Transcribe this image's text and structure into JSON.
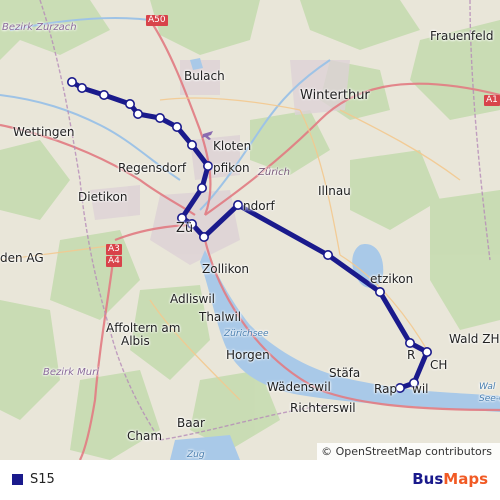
{
  "map": {
    "attribution": "© OpenStreetMap contributors",
    "labels": {
      "bezirk_zurzach": "Bezirk Zurzach",
      "bulach": "Bulach",
      "winterthur": "Winterthur",
      "frauenfeld": "Frauenfeld",
      "wettingen": "Wettingen",
      "kloten": "Kloten",
      "regensdorf": "Regensdorf",
      "opfikon": "pfikon",
      "zurich_italic": "Zürich",
      "illnau": "Illnau",
      "dietikon": "Dietikon",
      "zurich": "Zü",
      "dorf": "ndorf",
      "wetzikon": "etzikon",
      "zollikon": "Zollikon",
      "wald": "Wald ZH",
      "den_ag": "den AG",
      "adliswil": "Adliswil",
      "affoltern1": "Affoltern am",
      "affoltern2": "Albis",
      "thalwil": "Thalwil",
      "zurichsee": "Zürichsee",
      "horgen": "Horgen",
      "bezirk_muri": "Bezirk Muri",
      "stafa": "Stäfa",
      "r_ch": "R",
      "ch_suffix": "CH",
      "wadenswil": "Wädenswil",
      "rap": "Rap",
      "wil": "wil",
      "richterswil": "Richterswil",
      "walen": "Wal",
      "see_co": "See-Co",
      "baar": "Baar",
      "cham": "Cham",
      "zug": "Zug",
      "stadt": "dorf"
    },
    "shields": {
      "a50": "A50",
      "a1": "A1",
      "a3": "A3",
      "a4": "A4"
    },
    "route_color": "#1a1a8c",
    "stops_count_note": ""
  },
  "legend": {
    "line_name": "S15",
    "line_color": "#1a1a8c"
  },
  "brand": {
    "part1": "Bus",
    "part2": "Maps"
  }
}
